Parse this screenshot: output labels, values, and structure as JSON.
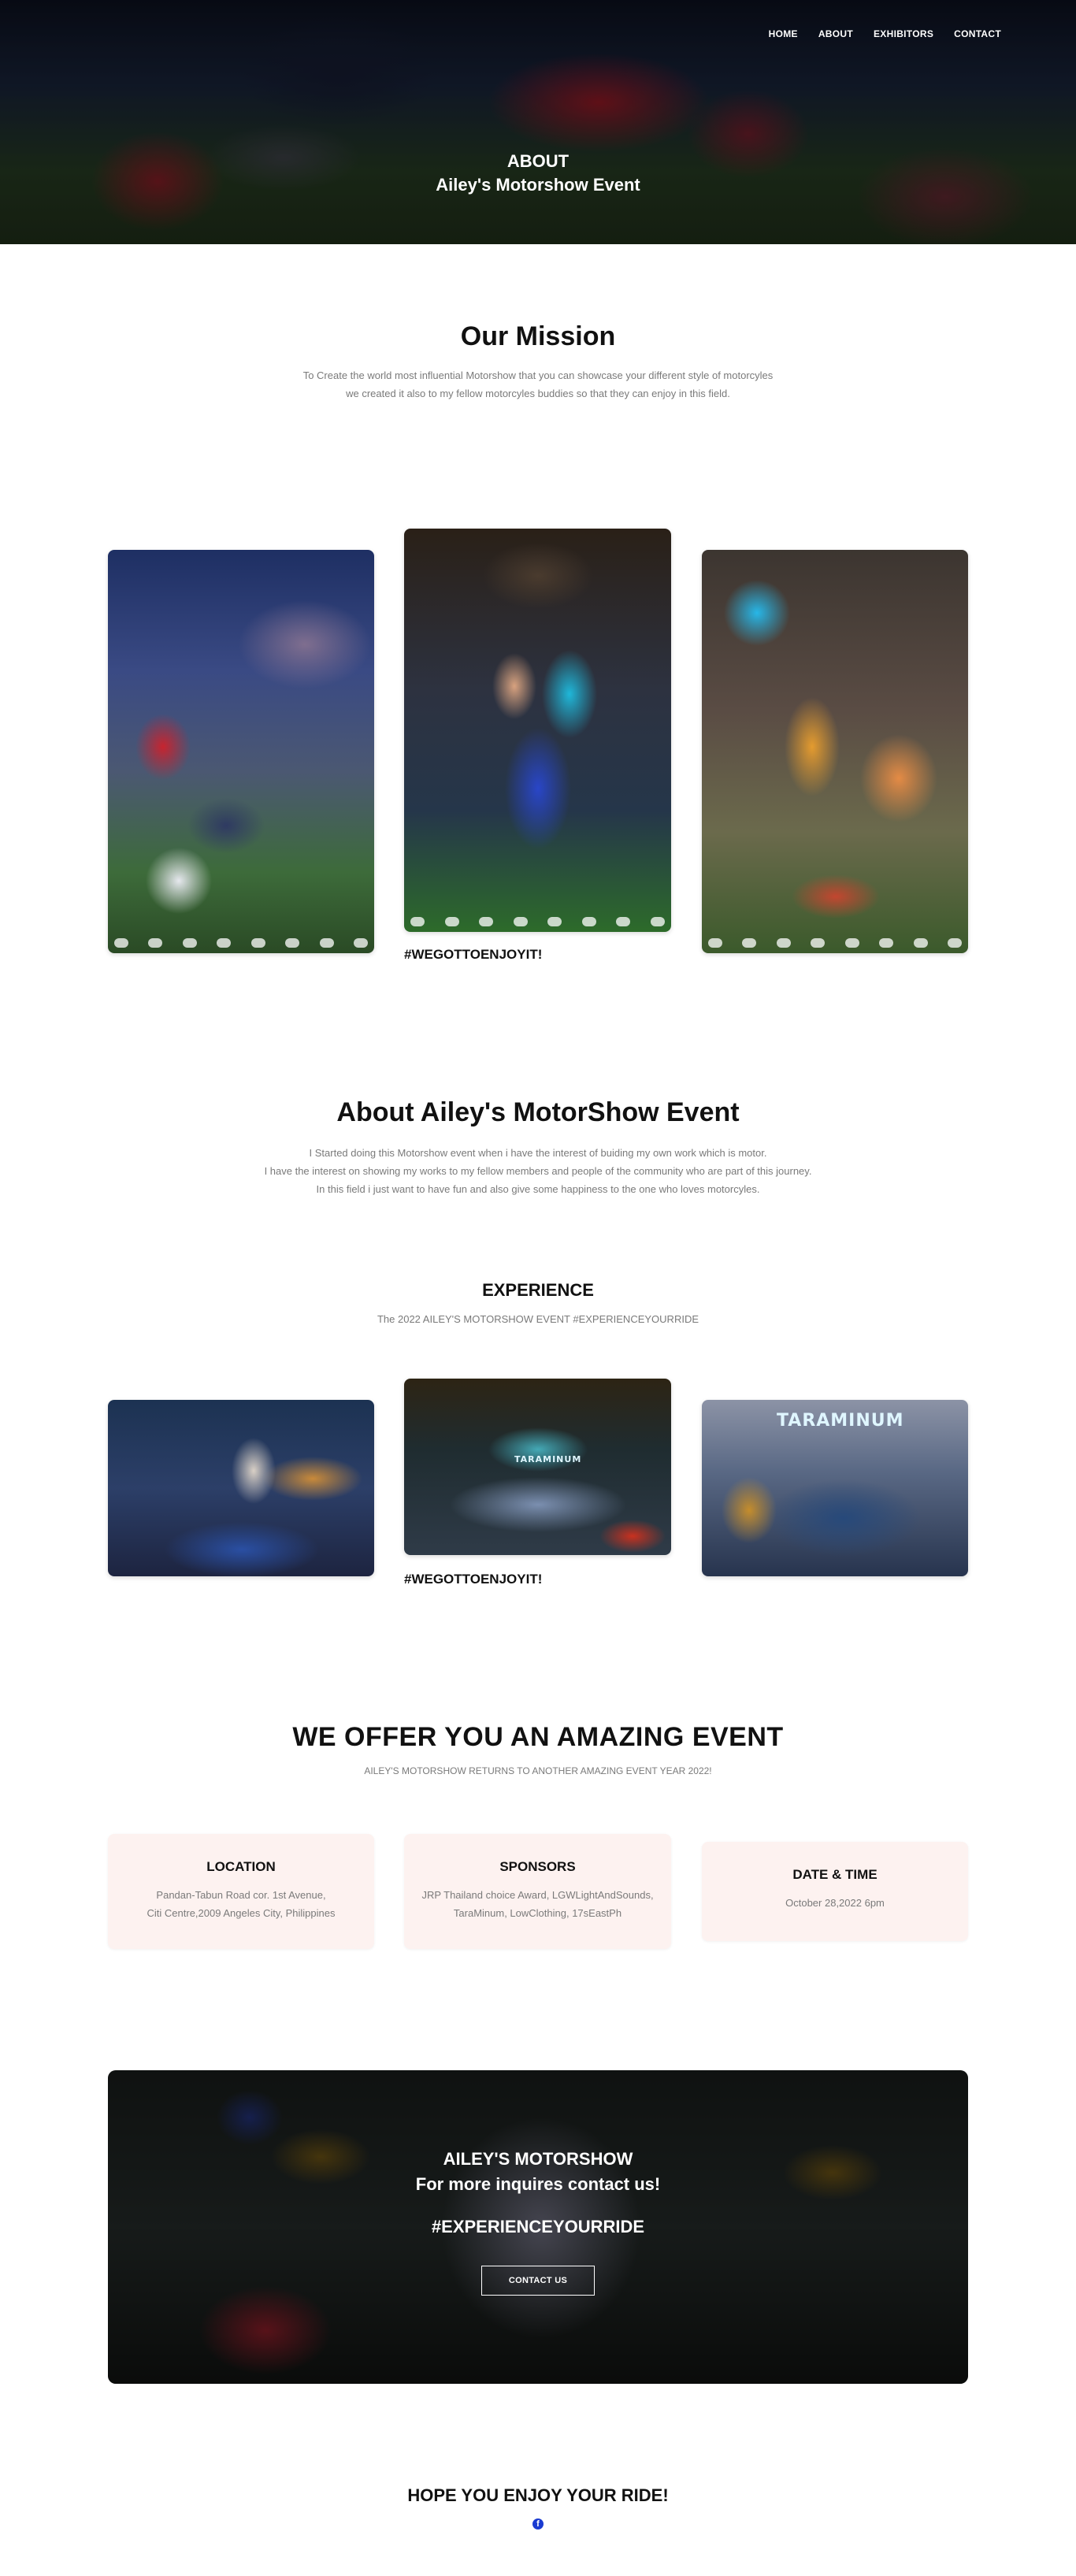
{
  "nav": {
    "items": [
      "HOME",
      "ABOUT",
      "EXHIBITORS",
      "CONTACT"
    ]
  },
  "hero": {
    "line1": "ABOUT",
    "line2": "Ailey's Motorshow Event"
  },
  "mission": {
    "title": "Our Mission",
    "text1": "To Create the world most influential Motorshow that you can showcase your different style of motorcyles",
    "text2": "we created it also to my fellow motorcyles buddies so that they can enjoy in this field."
  },
  "gallery1": {
    "caption": "#WEGOTTOENJOYIT!"
  },
  "about": {
    "title": "About Ailey's MotorShow Event",
    "text1": "I Started doing this Motorshow event when i have the interest of buiding my own work which is motor.",
    "text2": "I have the interest on showing my works to my fellow members and people of the community who are part of this journey.",
    "text3": "In this field i just want to have fun and also give some happiness to the one who loves motorcyles."
  },
  "experience": {
    "title": "EXPERIENCE",
    "subtitle": "The 2022 AILEY'S MOTORSHOW EVENT #EXPERIENCEYOURRIDE",
    "caption": "#WEGOTTOENJOYIT!",
    "sign": "TARAMINUM"
  },
  "offer": {
    "title": "WE OFFER YOU AN AMAZING EVENT",
    "subtitle": "AILEY'S MOTORSHOW RETURNS TO ANOTHER AMAZING EVENT YEAR 2022!",
    "cards": [
      {
        "title": "LOCATION",
        "line1": "Pandan-Tabun Road cor. 1st Avenue,",
        "line2": "Citi Centre,2009 Angeles City, Philippines"
      },
      {
        "title": "SPONSORS",
        "line1": "JRP Thailand choice Award, LGWLightAndSounds,",
        "line2": "TaraMinum, LowClothing, 17sEastPh"
      },
      {
        "title": "DATE & TIME",
        "line1": "October 28,2022 6pm",
        "line2": ""
      }
    ]
  },
  "cta": {
    "line1": "AILEY'S MOTORSHOW",
    "line2": "For more inquires contact us!",
    "line3": "#EXPERIENCEYOURRIDE",
    "button": "CONTACT US"
  },
  "footer": {
    "title": "HOPE YOU ENJOY YOUR RIDE!",
    "icon": "f"
  }
}
